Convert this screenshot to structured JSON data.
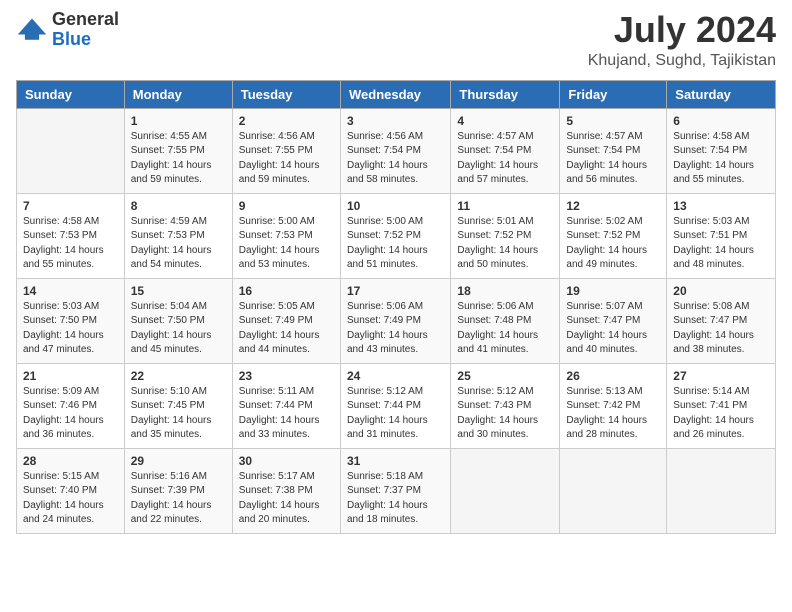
{
  "header": {
    "logo_general": "General",
    "logo_blue": "Blue",
    "month_year": "July 2024",
    "location": "Khujand, Sughd, Tajikistan"
  },
  "days_of_week": [
    "Sunday",
    "Monday",
    "Tuesday",
    "Wednesday",
    "Thursday",
    "Friday",
    "Saturday"
  ],
  "weeks": [
    [
      {
        "day": "",
        "sunrise": "",
        "sunset": "",
        "daylight": ""
      },
      {
        "day": "1",
        "sunrise": "Sunrise: 4:55 AM",
        "sunset": "Sunset: 7:55 PM",
        "daylight": "Daylight: 14 hours and 59 minutes."
      },
      {
        "day": "2",
        "sunrise": "Sunrise: 4:56 AM",
        "sunset": "Sunset: 7:55 PM",
        "daylight": "Daylight: 14 hours and 59 minutes."
      },
      {
        "day": "3",
        "sunrise": "Sunrise: 4:56 AM",
        "sunset": "Sunset: 7:54 PM",
        "daylight": "Daylight: 14 hours and 58 minutes."
      },
      {
        "day": "4",
        "sunrise": "Sunrise: 4:57 AM",
        "sunset": "Sunset: 7:54 PM",
        "daylight": "Daylight: 14 hours and 57 minutes."
      },
      {
        "day": "5",
        "sunrise": "Sunrise: 4:57 AM",
        "sunset": "Sunset: 7:54 PM",
        "daylight": "Daylight: 14 hours and 56 minutes."
      },
      {
        "day": "6",
        "sunrise": "Sunrise: 4:58 AM",
        "sunset": "Sunset: 7:54 PM",
        "daylight": "Daylight: 14 hours and 55 minutes."
      }
    ],
    [
      {
        "day": "7",
        "sunrise": "Sunrise: 4:58 AM",
        "sunset": "Sunset: 7:53 PM",
        "daylight": "Daylight: 14 hours and 55 minutes."
      },
      {
        "day": "8",
        "sunrise": "Sunrise: 4:59 AM",
        "sunset": "Sunset: 7:53 PM",
        "daylight": "Daylight: 14 hours and 54 minutes."
      },
      {
        "day": "9",
        "sunrise": "Sunrise: 5:00 AM",
        "sunset": "Sunset: 7:53 PM",
        "daylight": "Daylight: 14 hours and 53 minutes."
      },
      {
        "day": "10",
        "sunrise": "Sunrise: 5:00 AM",
        "sunset": "Sunset: 7:52 PM",
        "daylight": "Daylight: 14 hours and 51 minutes."
      },
      {
        "day": "11",
        "sunrise": "Sunrise: 5:01 AM",
        "sunset": "Sunset: 7:52 PM",
        "daylight": "Daylight: 14 hours and 50 minutes."
      },
      {
        "day": "12",
        "sunrise": "Sunrise: 5:02 AM",
        "sunset": "Sunset: 7:52 PM",
        "daylight": "Daylight: 14 hours and 49 minutes."
      },
      {
        "day": "13",
        "sunrise": "Sunrise: 5:03 AM",
        "sunset": "Sunset: 7:51 PM",
        "daylight": "Daylight: 14 hours and 48 minutes."
      }
    ],
    [
      {
        "day": "14",
        "sunrise": "Sunrise: 5:03 AM",
        "sunset": "Sunset: 7:50 PM",
        "daylight": "Daylight: 14 hours and 47 minutes."
      },
      {
        "day": "15",
        "sunrise": "Sunrise: 5:04 AM",
        "sunset": "Sunset: 7:50 PM",
        "daylight": "Daylight: 14 hours and 45 minutes."
      },
      {
        "day": "16",
        "sunrise": "Sunrise: 5:05 AM",
        "sunset": "Sunset: 7:49 PM",
        "daylight": "Daylight: 14 hours and 44 minutes."
      },
      {
        "day": "17",
        "sunrise": "Sunrise: 5:06 AM",
        "sunset": "Sunset: 7:49 PM",
        "daylight": "Daylight: 14 hours and 43 minutes."
      },
      {
        "day": "18",
        "sunrise": "Sunrise: 5:06 AM",
        "sunset": "Sunset: 7:48 PM",
        "daylight": "Daylight: 14 hours and 41 minutes."
      },
      {
        "day": "19",
        "sunrise": "Sunrise: 5:07 AM",
        "sunset": "Sunset: 7:47 PM",
        "daylight": "Daylight: 14 hours and 40 minutes."
      },
      {
        "day": "20",
        "sunrise": "Sunrise: 5:08 AM",
        "sunset": "Sunset: 7:47 PM",
        "daylight": "Daylight: 14 hours and 38 minutes."
      }
    ],
    [
      {
        "day": "21",
        "sunrise": "Sunrise: 5:09 AM",
        "sunset": "Sunset: 7:46 PM",
        "daylight": "Daylight: 14 hours and 36 minutes."
      },
      {
        "day": "22",
        "sunrise": "Sunrise: 5:10 AM",
        "sunset": "Sunset: 7:45 PM",
        "daylight": "Daylight: 14 hours and 35 minutes."
      },
      {
        "day": "23",
        "sunrise": "Sunrise: 5:11 AM",
        "sunset": "Sunset: 7:44 PM",
        "daylight": "Daylight: 14 hours and 33 minutes."
      },
      {
        "day": "24",
        "sunrise": "Sunrise: 5:12 AM",
        "sunset": "Sunset: 7:44 PM",
        "daylight": "Daylight: 14 hours and 31 minutes."
      },
      {
        "day": "25",
        "sunrise": "Sunrise: 5:12 AM",
        "sunset": "Sunset: 7:43 PM",
        "daylight": "Daylight: 14 hours and 30 minutes."
      },
      {
        "day": "26",
        "sunrise": "Sunrise: 5:13 AM",
        "sunset": "Sunset: 7:42 PM",
        "daylight": "Daylight: 14 hours and 28 minutes."
      },
      {
        "day": "27",
        "sunrise": "Sunrise: 5:14 AM",
        "sunset": "Sunset: 7:41 PM",
        "daylight": "Daylight: 14 hours and 26 minutes."
      }
    ],
    [
      {
        "day": "28",
        "sunrise": "Sunrise: 5:15 AM",
        "sunset": "Sunset: 7:40 PM",
        "daylight": "Daylight: 14 hours and 24 minutes."
      },
      {
        "day": "29",
        "sunrise": "Sunrise: 5:16 AM",
        "sunset": "Sunset: 7:39 PM",
        "daylight": "Daylight: 14 hours and 22 minutes."
      },
      {
        "day": "30",
        "sunrise": "Sunrise: 5:17 AM",
        "sunset": "Sunset: 7:38 PM",
        "daylight": "Daylight: 14 hours and 20 minutes."
      },
      {
        "day": "31",
        "sunrise": "Sunrise: 5:18 AM",
        "sunset": "Sunset: 7:37 PM",
        "daylight": "Daylight: 14 hours and 18 minutes."
      },
      {
        "day": "",
        "sunrise": "",
        "sunset": "",
        "daylight": ""
      },
      {
        "day": "",
        "sunrise": "",
        "sunset": "",
        "daylight": ""
      },
      {
        "day": "",
        "sunrise": "",
        "sunset": "",
        "daylight": ""
      }
    ]
  ]
}
